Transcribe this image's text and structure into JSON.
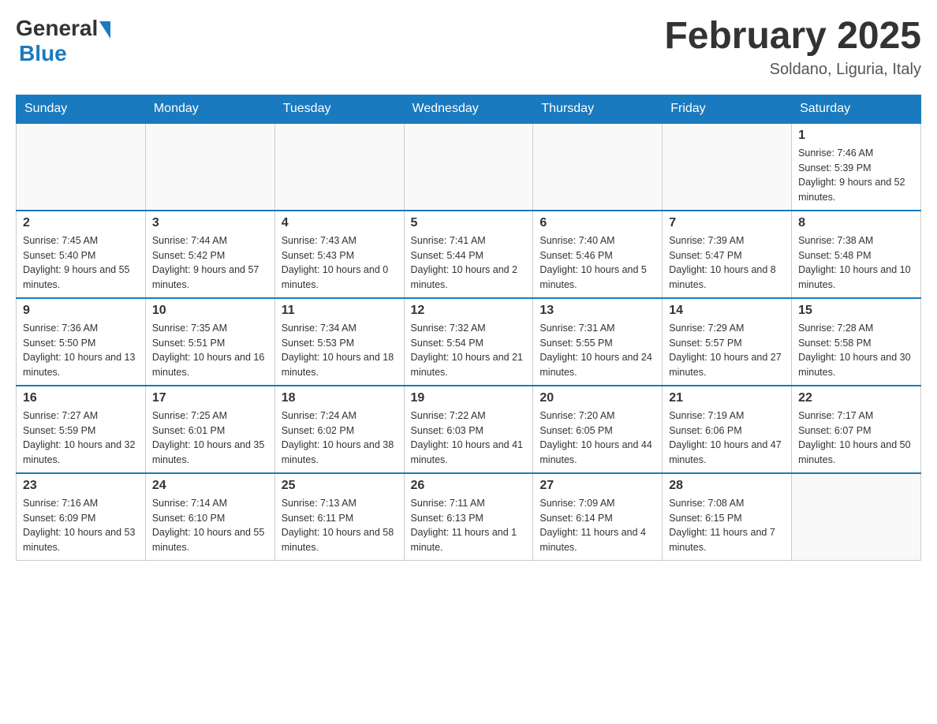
{
  "logo": {
    "general": "General",
    "blue": "Blue"
  },
  "title": "February 2025",
  "location": "Soldano, Liguria, Italy",
  "days_of_week": [
    "Sunday",
    "Monday",
    "Tuesday",
    "Wednesday",
    "Thursday",
    "Friday",
    "Saturday"
  ],
  "weeks": [
    [
      {
        "day": "",
        "info": ""
      },
      {
        "day": "",
        "info": ""
      },
      {
        "day": "",
        "info": ""
      },
      {
        "day": "",
        "info": ""
      },
      {
        "day": "",
        "info": ""
      },
      {
        "day": "",
        "info": ""
      },
      {
        "day": "1",
        "info": "Sunrise: 7:46 AM\nSunset: 5:39 PM\nDaylight: 9 hours and 52 minutes."
      }
    ],
    [
      {
        "day": "2",
        "info": "Sunrise: 7:45 AM\nSunset: 5:40 PM\nDaylight: 9 hours and 55 minutes."
      },
      {
        "day": "3",
        "info": "Sunrise: 7:44 AM\nSunset: 5:42 PM\nDaylight: 9 hours and 57 minutes."
      },
      {
        "day": "4",
        "info": "Sunrise: 7:43 AM\nSunset: 5:43 PM\nDaylight: 10 hours and 0 minutes."
      },
      {
        "day": "5",
        "info": "Sunrise: 7:41 AM\nSunset: 5:44 PM\nDaylight: 10 hours and 2 minutes."
      },
      {
        "day": "6",
        "info": "Sunrise: 7:40 AM\nSunset: 5:46 PM\nDaylight: 10 hours and 5 minutes."
      },
      {
        "day": "7",
        "info": "Sunrise: 7:39 AM\nSunset: 5:47 PM\nDaylight: 10 hours and 8 minutes."
      },
      {
        "day": "8",
        "info": "Sunrise: 7:38 AM\nSunset: 5:48 PM\nDaylight: 10 hours and 10 minutes."
      }
    ],
    [
      {
        "day": "9",
        "info": "Sunrise: 7:36 AM\nSunset: 5:50 PM\nDaylight: 10 hours and 13 minutes."
      },
      {
        "day": "10",
        "info": "Sunrise: 7:35 AM\nSunset: 5:51 PM\nDaylight: 10 hours and 16 minutes."
      },
      {
        "day": "11",
        "info": "Sunrise: 7:34 AM\nSunset: 5:53 PM\nDaylight: 10 hours and 18 minutes."
      },
      {
        "day": "12",
        "info": "Sunrise: 7:32 AM\nSunset: 5:54 PM\nDaylight: 10 hours and 21 minutes."
      },
      {
        "day": "13",
        "info": "Sunrise: 7:31 AM\nSunset: 5:55 PM\nDaylight: 10 hours and 24 minutes."
      },
      {
        "day": "14",
        "info": "Sunrise: 7:29 AM\nSunset: 5:57 PM\nDaylight: 10 hours and 27 minutes."
      },
      {
        "day": "15",
        "info": "Sunrise: 7:28 AM\nSunset: 5:58 PM\nDaylight: 10 hours and 30 minutes."
      }
    ],
    [
      {
        "day": "16",
        "info": "Sunrise: 7:27 AM\nSunset: 5:59 PM\nDaylight: 10 hours and 32 minutes."
      },
      {
        "day": "17",
        "info": "Sunrise: 7:25 AM\nSunset: 6:01 PM\nDaylight: 10 hours and 35 minutes."
      },
      {
        "day": "18",
        "info": "Sunrise: 7:24 AM\nSunset: 6:02 PM\nDaylight: 10 hours and 38 minutes."
      },
      {
        "day": "19",
        "info": "Sunrise: 7:22 AM\nSunset: 6:03 PM\nDaylight: 10 hours and 41 minutes."
      },
      {
        "day": "20",
        "info": "Sunrise: 7:20 AM\nSunset: 6:05 PM\nDaylight: 10 hours and 44 minutes."
      },
      {
        "day": "21",
        "info": "Sunrise: 7:19 AM\nSunset: 6:06 PM\nDaylight: 10 hours and 47 minutes."
      },
      {
        "day": "22",
        "info": "Sunrise: 7:17 AM\nSunset: 6:07 PM\nDaylight: 10 hours and 50 minutes."
      }
    ],
    [
      {
        "day": "23",
        "info": "Sunrise: 7:16 AM\nSunset: 6:09 PM\nDaylight: 10 hours and 53 minutes."
      },
      {
        "day": "24",
        "info": "Sunrise: 7:14 AM\nSunset: 6:10 PM\nDaylight: 10 hours and 55 minutes."
      },
      {
        "day": "25",
        "info": "Sunrise: 7:13 AM\nSunset: 6:11 PM\nDaylight: 10 hours and 58 minutes."
      },
      {
        "day": "26",
        "info": "Sunrise: 7:11 AM\nSunset: 6:13 PM\nDaylight: 11 hours and 1 minute."
      },
      {
        "day": "27",
        "info": "Sunrise: 7:09 AM\nSunset: 6:14 PM\nDaylight: 11 hours and 4 minutes."
      },
      {
        "day": "28",
        "info": "Sunrise: 7:08 AM\nSunset: 6:15 PM\nDaylight: 11 hours and 7 minutes."
      },
      {
        "day": "",
        "info": ""
      }
    ]
  ]
}
